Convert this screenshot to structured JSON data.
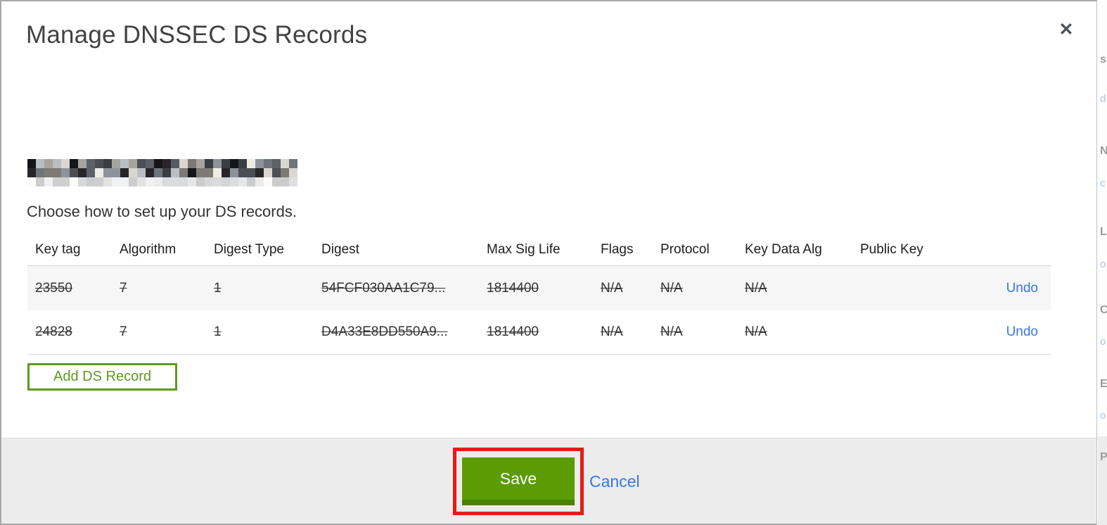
{
  "modal": {
    "title": "Manage DNSSEC DS Records",
    "close_icon": "✕",
    "instruction": "Choose how to set up your DS records.",
    "add_record_label": "Add DS Record",
    "save_label": "Save",
    "cancel_label": "Cancel",
    "domain_redacted": true
  },
  "table": {
    "headers": [
      "Key tag",
      "Algorithm",
      "Digest Type",
      "Digest",
      "Max Sig Life",
      "Flags",
      "Protocol",
      "Key Data Alg",
      "Public Key"
    ],
    "rows": [
      {
        "cells": [
          "23550",
          "7",
          "1",
          "54FCF030AA1C79...",
          "1814400",
          "N/A",
          "N/A",
          "N/A",
          ""
        ],
        "undo_label": "Undo",
        "deleted": true
      },
      {
        "cells": [
          "24828",
          "7",
          "1",
          "D4A33E8DD550A9...",
          "1814400",
          "N/A",
          "N/A",
          "N/A",
          ""
        ],
        "undo_label": "Undo",
        "deleted": true
      }
    ]
  },
  "colors": {
    "accent_green": "#5b9b04",
    "outline_green": "#5c9a20",
    "link_blue": "#3478e6",
    "annotation_red": "#e41b17",
    "footer_gray": "#ececec"
  },
  "background_strip": {
    "fragments": [
      {
        "char": "s",
        "kind": "g"
      },
      {
        "char": "d",
        "kind": "b"
      },
      {
        "char": "N",
        "kind": "g"
      },
      {
        "char": "c",
        "kind": "b"
      },
      {
        "char": "L",
        "kind": "g"
      },
      {
        "char": "o",
        "kind": "b"
      },
      {
        "char": "C",
        "kind": "g"
      },
      {
        "char": "o",
        "kind": "b"
      },
      {
        "char": "E",
        "kind": "g"
      },
      {
        "char": "o",
        "kind": "b"
      },
      {
        "char": "P",
        "kind": "g"
      }
    ]
  }
}
